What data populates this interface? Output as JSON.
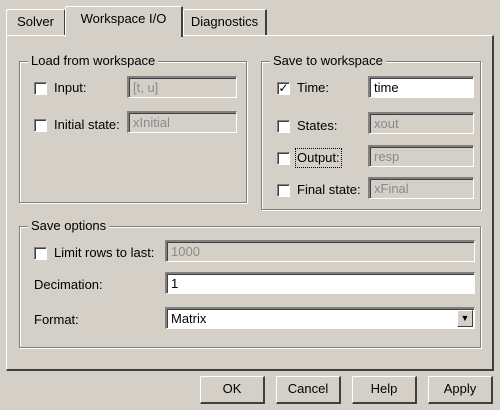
{
  "tabs": [
    {
      "label": "Solver",
      "active": false
    },
    {
      "label": "Workspace I/O",
      "active": true
    },
    {
      "label": "Diagnostics",
      "active": false
    }
  ],
  "load": {
    "title": "Load from workspace",
    "input": {
      "label": "Input:",
      "checked": false,
      "value": "[t, u]"
    },
    "initial_state": {
      "label": "Initial state:",
      "checked": false,
      "value": "xInitial"
    }
  },
  "save": {
    "title": "Save to workspace",
    "time": {
      "label": "Time:",
      "checked": true,
      "check_glyph": "✓",
      "value": "time"
    },
    "states": {
      "label": "States:",
      "checked": false,
      "value": "xout"
    },
    "output": {
      "label": "Output:",
      "checked": false,
      "value": "resp"
    },
    "final_state": {
      "label": "Final state:",
      "checked": false,
      "value": "xFinal"
    }
  },
  "options": {
    "title": "Save options",
    "limit_rows": {
      "label": "Limit rows to last:",
      "checked": false,
      "value": "1000"
    },
    "decimation": {
      "label": "Decimation:",
      "value": "1"
    },
    "format": {
      "label": "Format:",
      "value": "Matrix",
      "arrow_glyph": "▼"
    }
  },
  "buttons": {
    "ok": "OK",
    "cancel": "Cancel",
    "help": "Help",
    "apply": "Apply"
  }
}
